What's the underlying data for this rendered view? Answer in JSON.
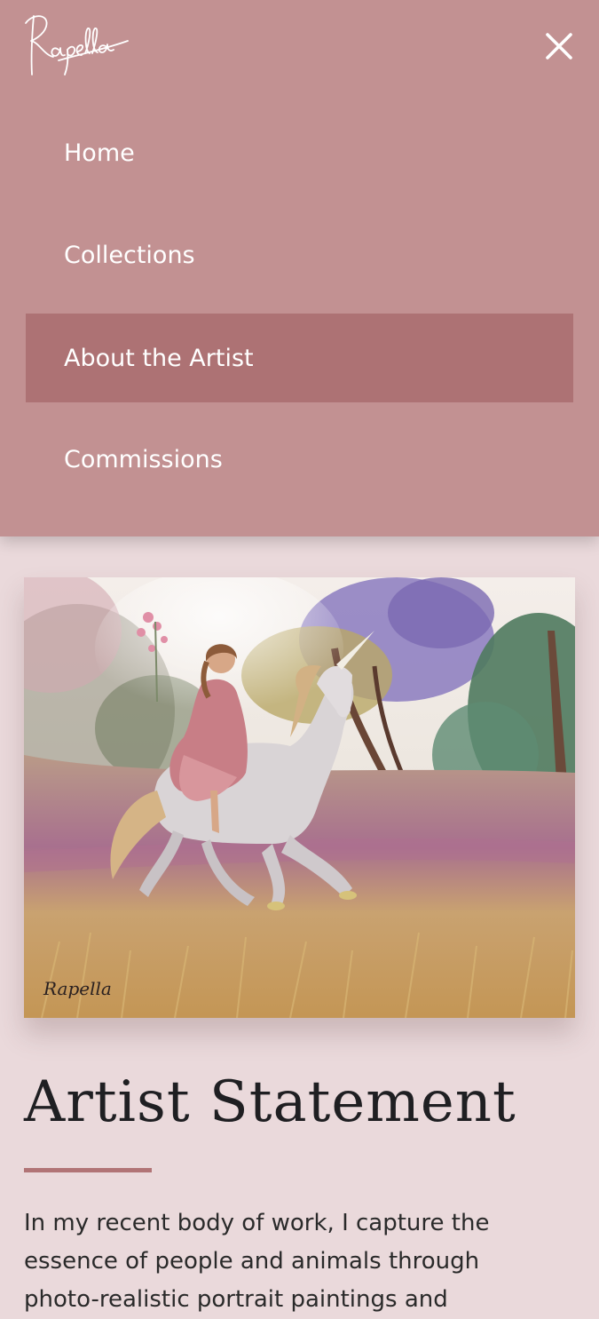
{
  "brand": {
    "logo_text": "Rapella",
    "logo_icon": "signature-logo"
  },
  "menu": {
    "close_icon": "close-icon",
    "items": [
      {
        "label": "Home",
        "active": false
      },
      {
        "label": "Collections",
        "active": false
      },
      {
        "label": "About the Artist",
        "active": true
      },
      {
        "label": "Commissions",
        "active": false
      }
    ]
  },
  "artwork": {
    "signature": "Rapella"
  },
  "statement": {
    "heading": "Artist Statement",
    "body": "In my recent body of work, I capture the essence of people and animals through photo-realistic portrait paintings and"
  },
  "colors": {
    "menu_background": "#c29192",
    "menu_active": "#ad7274",
    "page_background": "#ead9db",
    "accent_divider": "#b17476"
  }
}
